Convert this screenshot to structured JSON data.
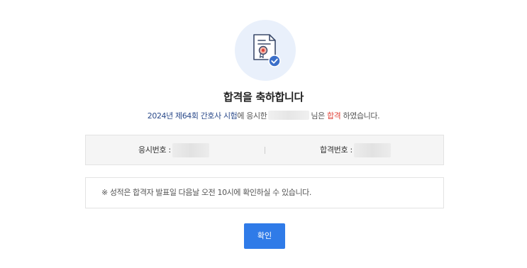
{
  "icon": "certificate-check-icon",
  "title": "합격을 축하합니다",
  "message": {
    "exam_name": "2024년 제64회 간호사 시험",
    "after_exam": "에 응시한",
    "after_name": "님은",
    "result": "합격",
    "ending": "하였습니다."
  },
  "info": {
    "exam_number_label": "응시번호 :",
    "pass_number_label": "합격번호 :"
  },
  "notice": "※ 성적은 합격자 발표일 다음날 오전 10시에 확인하실 수 있습니다.",
  "confirm_button": "확인",
  "colors": {
    "accent": "#2f7be8",
    "icon_bg": "#e9f0fb",
    "exam_text": "#2b4a8a",
    "pass_text": "#e0443a"
  }
}
